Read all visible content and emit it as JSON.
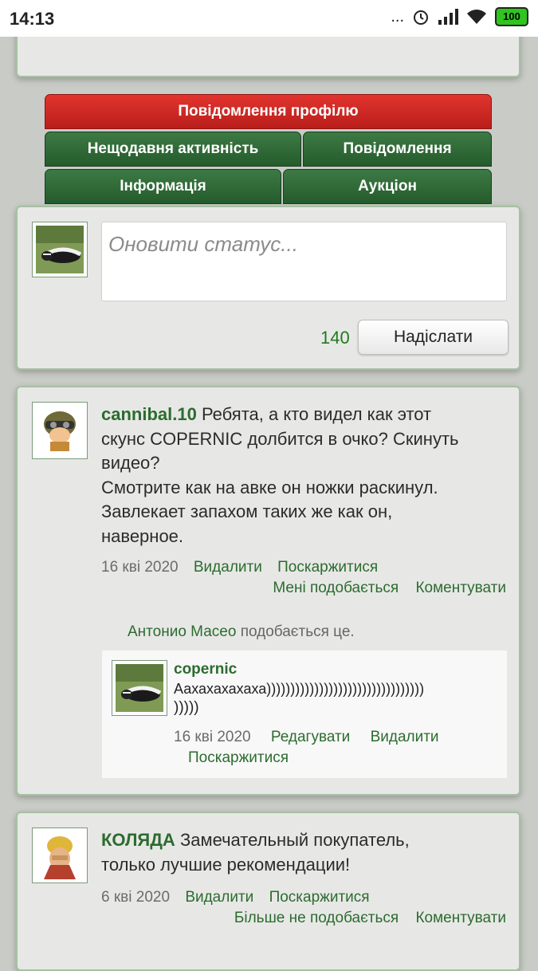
{
  "status_bar": {
    "time": "14:13",
    "dots": "...",
    "battery": "100"
  },
  "tabs": {
    "profile_messages": "Повідомлення профілю",
    "recent_activity": "Нещодавня активність",
    "messages": "Повідомлення",
    "info": "Інформація",
    "auction": "Аукціон"
  },
  "composer": {
    "placeholder": "Оновити статус...",
    "counter": "140",
    "send_label": "Надіслати"
  },
  "posts": [
    {
      "author": "cannibal.10",
      "text_line1": "Ребята, а кто видел как этот",
      "text_line2": "скунс COPERNIC долбится в очко? Скинуть",
      "text_line3": "видео?",
      "text_line4": "Смотрите как на авке он ножки раскинул.",
      "text_line5": "Завлекает запахом таких же как он,",
      "text_line6": "наверное.",
      "date": "16 кві 2020",
      "delete": "Видалити",
      "report": "Поскаржитися",
      "like": "Мені подобається",
      "comment": "Коментувати",
      "liked_by_name": "Антонио Масео",
      "liked_by_suffix": "подобається це.",
      "reply": {
        "author": "copernic",
        "text_line1": "Аахахахахаха)))))))))))))))))))))))))))))))))",
        "text_line2": ")))))",
        "date": "16 кві 2020",
        "edit": "Редагувати",
        "delete": "Видалити",
        "report": "Поскаржитися"
      }
    },
    {
      "author": "КОЛЯДА",
      "text_line1": "Замечательный покупатель,",
      "text_line2": "только лучшие рекомендации!",
      "date": "6 кві 2020",
      "delete": "Видалити",
      "report": "Поскаржитися",
      "unlike": "Більше не подобається",
      "comment": "Коментувати"
    }
  ],
  "colors": {
    "accent_green": "#2d6b2f",
    "tab_red": "#c9221f",
    "tab_green": "#2f6a36"
  }
}
